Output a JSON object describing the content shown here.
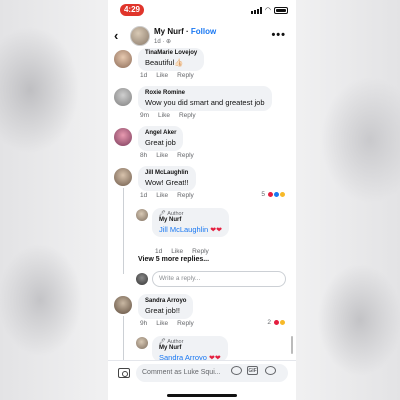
{
  "status": {
    "time": "4:29"
  },
  "header": {
    "back_glyph": "‹",
    "page_name": "My Nurf",
    "separator": " · ",
    "follow_label": "Follow",
    "meta": "1d · ⊕",
    "more_glyph": "•••"
  },
  "actions": {
    "like": "Like",
    "reply": "Reply"
  },
  "comments": [
    {
      "name": "TinaMarie Lovejoy",
      "text": "Beautiful👍🏻",
      "age": "1d"
    },
    {
      "name": "Roxie Romine",
      "text": "Wow you did  smart and greatest job",
      "age": "9m"
    },
    {
      "name": "Angel Aker",
      "text": "Great job",
      "age": "8h"
    },
    {
      "name": "Jill McLaughlin",
      "text": "Wow! Great!!",
      "age": "1d",
      "reaction_count": "5"
    },
    {
      "name": "Sandra Arroyo",
      "text": "Great job!!",
      "age": "9h",
      "reaction_count": "2"
    }
  ],
  "replies": [
    {
      "badge": "🖋 Author",
      "name": "My Nurf",
      "mention": "Jill McLaughlin",
      "hearts": "❤❤",
      "age": "1d"
    },
    {
      "badge": "🖋 Author",
      "name": "My Nurf",
      "mention": "Sandra Arroyo",
      "hearts": "❤❤"
    }
  ],
  "view_more": "View 5 more replies...",
  "reply_placeholder": "Write a reply...",
  "bottom": {
    "comment_placeholder": "Comment as Luke Squi...",
    "gif_label": "GIF"
  },
  "colors": {
    "accent": "#1877f2",
    "status_pill": "#e0352b",
    "heart": "#e41e3f"
  }
}
